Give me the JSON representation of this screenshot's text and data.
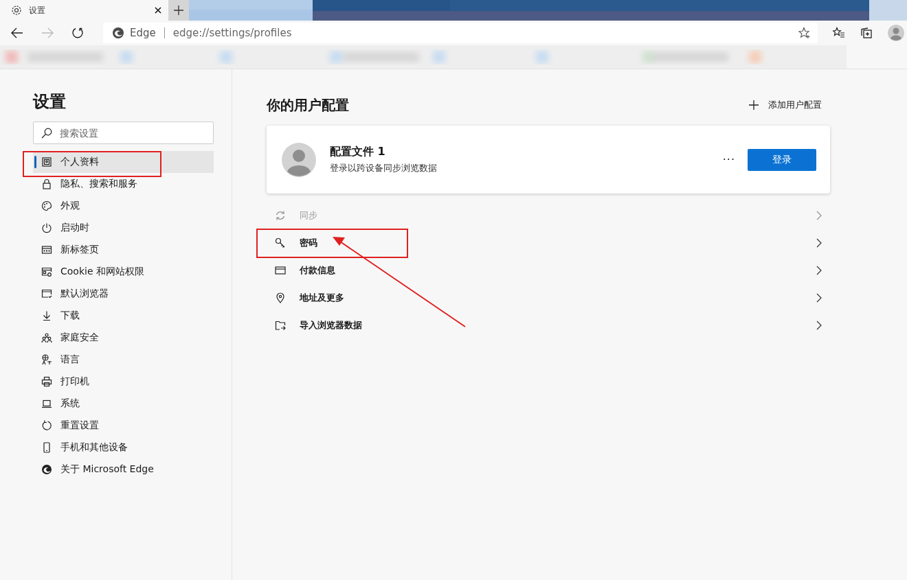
{
  "tab": {
    "title": "设置",
    "selected": true
  },
  "address_bar": {
    "site_label": "Edge",
    "url": "edge://settings/profiles"
  },
  "sidebar": {
    "title": "设置",
    "search": {
      "placeholder": "搜索设置"
    },
    "items": [
      {
        "label": "个人资料",
        "selected": true
      },
      {
        "label": "隐私、搜索和服务",
        "selected": false
      },
      {
        "label": "外观",
        "selected": false
      },
      {
        "label": "启动时",
        "selected": false
      },
      {
        "label": "新标签页",
        "selected": false
      },
      {
        "label": "Cookie 和网站权限",
        "selected": false
      },
      {
        "label": "默认浏览器",
        "selected": false
      },
      {
        "label": "下载",
        "selected": false
      },
      {
        "label": "家庭安全",
        "selected": false
      },
      {
        "label": "语言",
        "selected": false
      },
      {
        "label": "打印机",
        "selected": false
      },
      {
        "label": "系统",
        "selected": false
      },
      {
        "label": "重置设置",
        "selected": false
      },
      {
        "label": "手机和其他设备",
        "selected": false
      },
      {
        "label": "关于 Microsoft Edge",
        "selected": false
      }
    ]
  },
  "main": {
    "title": "你的用户配置",
    "add_profile": "添加用户配置",
    "profile": {
      "name": "配置文件 1",
      "subtitle": "登录以跨设备同步浏览数据",
      "more": "···",
      "sign_in": "登录"
    },
    "rows": [
      {
        "label": "同步",
        "disabled": true
      },
      {
        "label": "密码",
        "disabled": false
      },
      {
        "label": "付款信息",
        "disabled": false
      },
      {
        "label": "地址及更多",
        "disabled": false
      },
      {
        "label": "导入浏览器数据",
        "disabled": false
      }
    ]
  }
}
